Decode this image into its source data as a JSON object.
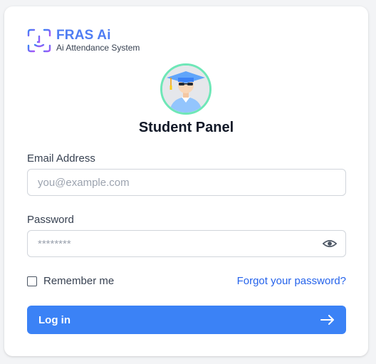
{
  "brand": {
    "name": "FRAS Ai",
    "tagline": "Ai Attendance System"
  },
  "panel": {
    "title": "Student Panel"
  },
  "form": {
    "email_label": "Email Address",
    "email_placeholder": "you@example.com",
    "email_value": "",
    "password_label": "Password",
    "password_placeholder": "********",
    "password_value": "",
    "remember_label": "Remember me",
    "remember_checked": false,
    "forgot_link": "Forgot your password?",
    "login_label": "Log in"
  },
  "icons": {
    "logo": "face-scan-icon",
    "avatar": "graduate-avatar",
    "password_toggle": "eye-icon",
    "submit": "arrow-right-icon"
  },
  "colors": {
    "accent": "#3b82f6",
    "link": "#2563eb",
    "avatar_ring": "#6ee7b7"
  }
}
